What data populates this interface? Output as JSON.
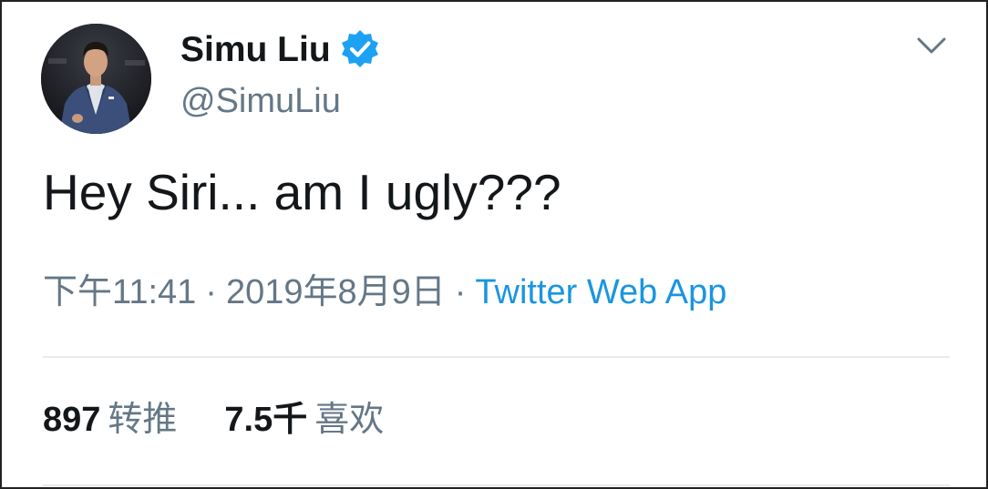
{
  "tweet": {
    "author": {
      "display_name": "Simu Liu",
      "handle": "@SimuLiu",
      "verified": true,
      "avatar_icon": "profile-photo"
    },
    "text": "Hey Siri... am I ugly???",
    "meta": {
      "time": "下午11:41",
      "separator": "·",
      "date": "2019年8月9日",
      "source": "Twitter Web App"
    },
    "stats": {
      "retweets_count": "897",
      "retweets_label": "转推",
      "likes_count": "7.5千",
      "likes_label": "喜欢"
    }
  },
  "colors": {
    "text_primary": "#14171a",
    "text_secondary": "#657786",
    "link": "#1b95e0",
    "verified_badge": "#1da1f2",
    "divider": "#e6ecf0"
  },
  "icons": {
    "verified": "verified-badge-icon",
    "menu": "chevron-down-icon"
  }
}
